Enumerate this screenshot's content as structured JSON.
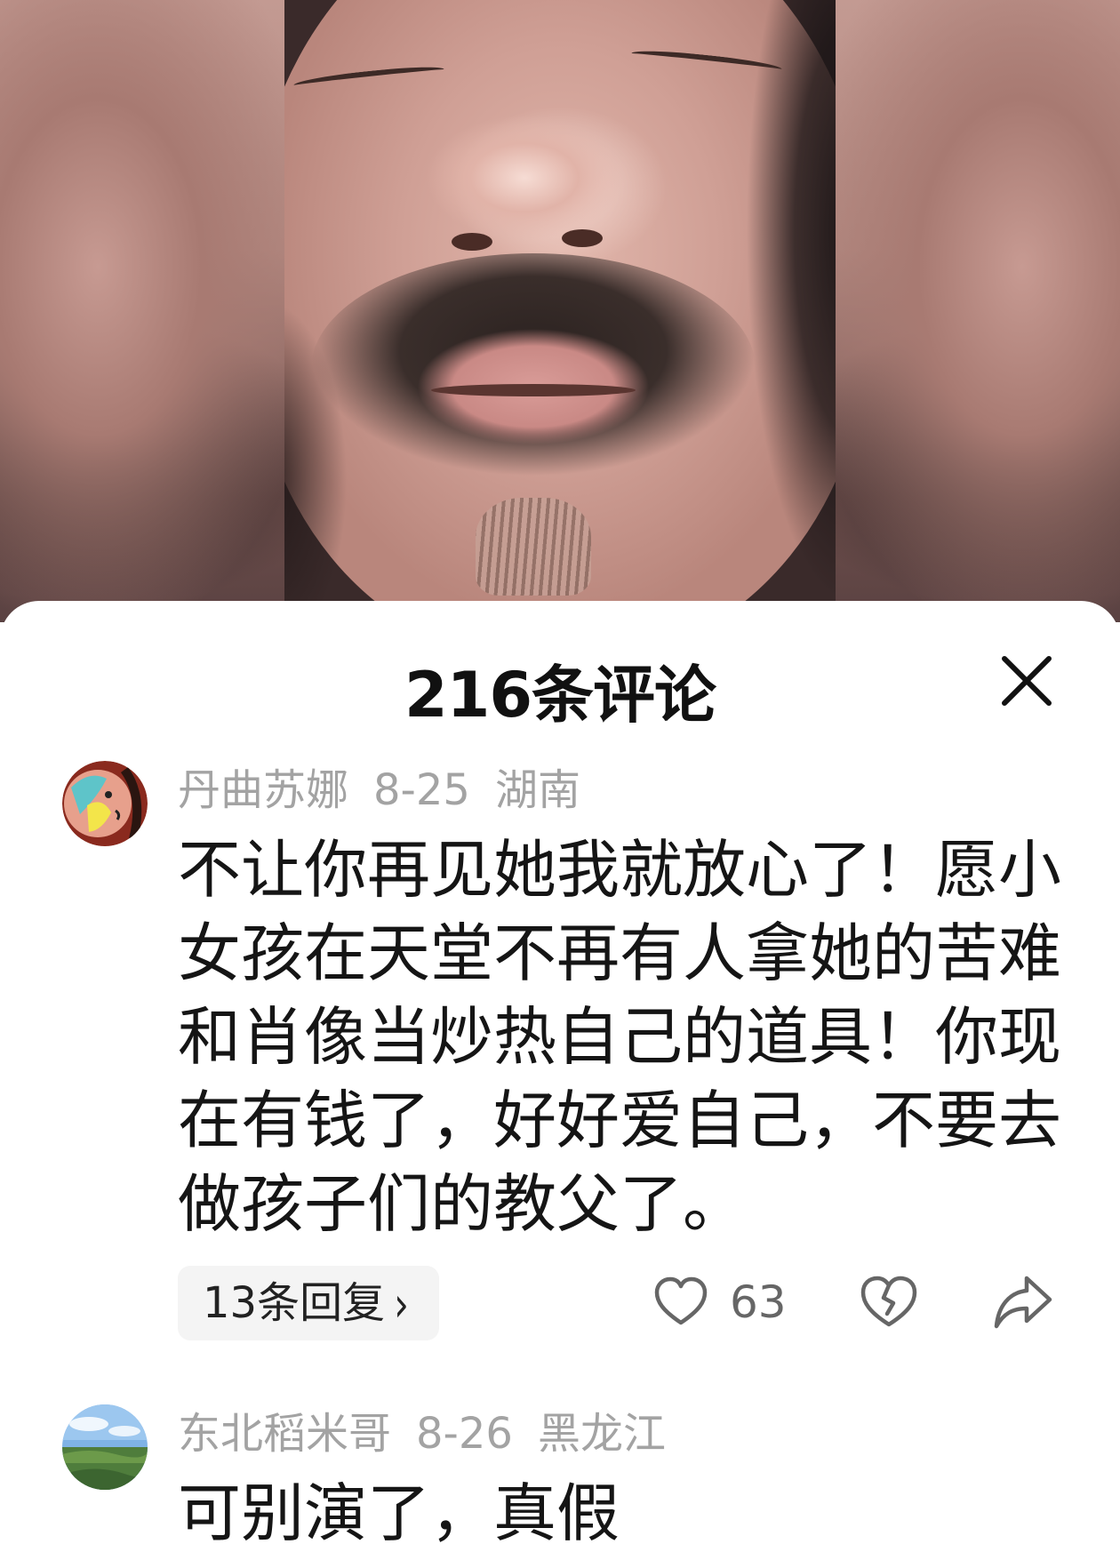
{
  "comments_panel": {
    "title": "216条评论",
    "close_icon": "close-icon"
  },
  "comments": [
    {
      "username": "丹曲苏娜",
      "date": "8-25",
      "location": "湖南",
      "text": "不让你再见她我就放心了！愿小女孩在天堂不再有人拿她的苦难和肖像当炒热自己的道具！你现在有钱了，好好爱自己，不要去做孩子们的教父了。",
      "replies_label": "13条回复",
      "likes": "63",
      "icons": [
        "heart-icon",
        "broken-heart-icon",
        "share-arrow-icon",
        "chevron-right-icon"
      ]
    },
    {
      "username": "东北稻米哥",
      "date": "8-26",
      "location": "黑龙江",
      "text": "可别演了，真假"
    }
  ],
  "colors": {
    "title_text": "#111111",
    "meta_text": "#a3a3a3",
    "body_text": "#151515",
    "pill_background": "#f4f4f4",
    "icon_stroke": "#666666"
  }
}
